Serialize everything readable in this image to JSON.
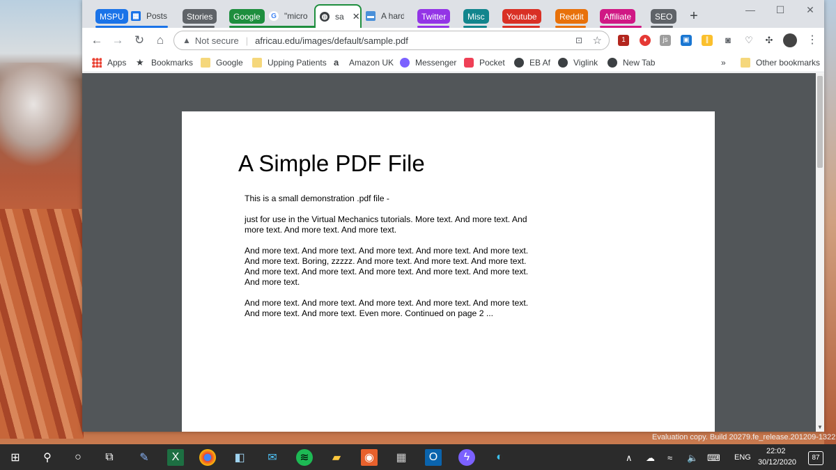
{
  "groups": [
    {
      "label": "MSPU",
      "color": "#1a73e8"
    },
    {
      "label": "Stories",
      "color": "#5f6368"
    },
    {
      "label": "Google",
      "color": "#1e8e3e"
    },
    {
      "label": "Twitter",
      "color": "#9334e6"
    },
    {
      "label": "Misc",
      "color": "#12858d"
    },
    {
      "label": "Youtube",
      "color": "#d93025"
    },
    {
      "label": "Reddit",
      "color": "#e8710a"
    },
    {
      "label": "Affiliate",
      "color": "#d01884"
    },
    {
      "label": "SEO",
      "color": "#5f6368"
    }
  ],
  "tabs": {
    "posts": "Posts",
    "micro": "\"micro",
    "active": "sa",
    "hard": "A hard"
  },
  "toolbar": {
    "security": "Not secure",
    "url": "africau.edu/images/default/sample.pdf",
    "ext_badge": "1"
  },
  "bookmarks": [
    "Apps",
    "Bookmarks",
    "Google",
    "Upping Patients",
    "Amazon UK",
    "Messenger",
    "Pocket",
    "EB Af",
    "Viglink",
    "New Tab"
  ],
  "bookmarks_more": "»",
  "other_bookmarks": "Other bookmarks",
  "pdf": {
    "title": "A Simple PDF File",
    "paragraphs": [
      "This is a small demonstration .pdf file -",
      "just for use in the Virtual Mechanics tutorials. More text. And more text. And more text. And more text. And more text.",
      "And more text. And more text. And more text. And more text. And more text. And more text. Boring, zzzzz. And more text. And more text. And more text. And more text. And more text. And more text. And more text. And more text. And more text.",
      "And more text. And more text. And more text. And more text. And more text. And more text. And more text. Even more. Continued on page 2 ..."
    ]
  },
  "watermark": "Evaluation copy. Build 20279.fe_release.201209-1322",
  "taskbar": {
    "lang": "ENG",
    "time": "22:02",
    "date": "30/12/2020",
    "notif": "87"
  },
  "colors": {
    "tabstrip": "#dee1e6",
    "viewer": "#525659",
    "taskbar": "#2b2b2b"
  }
}
